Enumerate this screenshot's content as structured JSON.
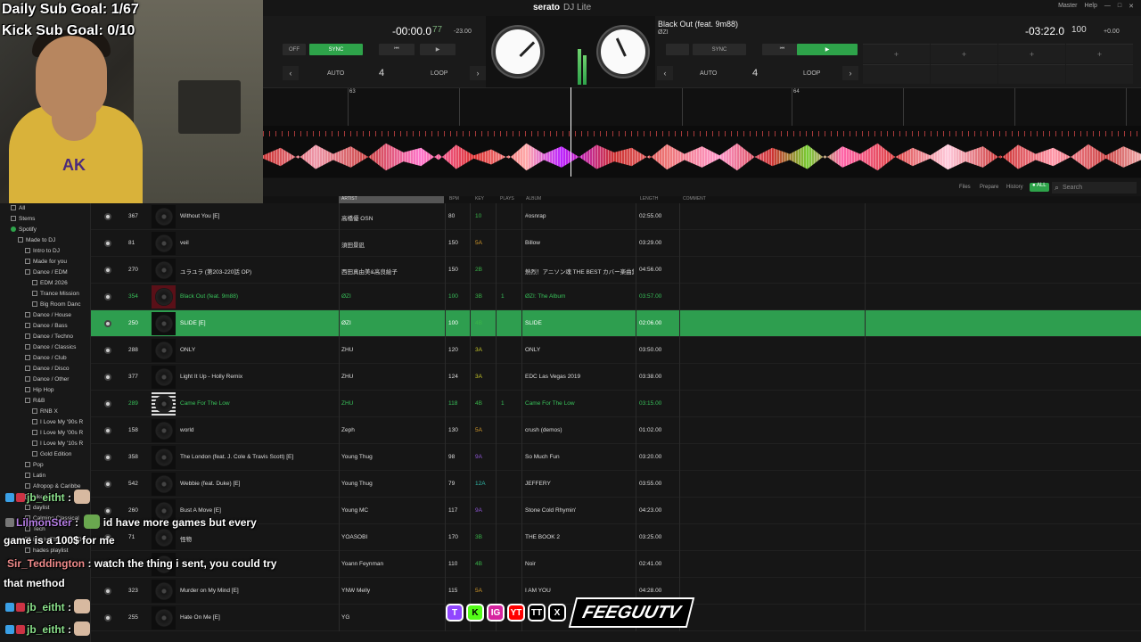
{
  "overlay": {
    "daily_goal": "Daily Sub Goal: 1/67",
    "kick_goal": "Kick Sub Goal: 0/10",
    "brand": "FEEGUUTV",
    "jersey": "AK"
  },
  "app": {
    "logo": "serato",
    "logo_sub": "DJ Lite",
    "top_right": [
      "Master",
      "Help",
      "—",
      "□",
      "✕"
    ]
  },
  "deck_left": {
    "time": "-00:00.0",
    "bpm": "77",
    "offset": "-23.00",
    "off_label": "OFF",
    "sync_label": "SYNC",
    "auto_label": "AUTO",
    "loop_label": "LOOP",
    "loop_value": "4"
  },
  "deck_right": {
    "title": "Black Out (feat. 9m88)",
    "artist": "ØZI",
    "time": "-03:22.0",
    "bpm": "100",
    "offset": "+0.00",
    "sync_label": "SYNC",
    "auto_label": "AUTO",
    "loop_label": "LOOP",
    "loop_value": "4"
  },
  "beat_markers": [
    "63",
    "64"
  ],
  "library": {
    "tools": [
      "Files",
      "Prepare",
      "History"
    ],
    "search_placeholder": "Search",
    "columns": [
      "ARTIST",
      "BPM",
      "KEY",
      "PLAYS",
      "ALBUM",
      "LENGTH",
      "COMMENT"
    ]
  },
  "sidebar": [
    {
      "label": "All"
    },
    {
      "label": "Stems"
    },
    {
      "label": "Spotify"
    },
    {
      "label": "Made to DJ"
    },
    {
      "label": "Intro to DJ"
    },
    {
      "label": "Made for you"
    },
    {
      "label": "Dance / EDM"
    },
    {
      "label": "EDM 2026"
    },
    {
      "label": "Trance Mission"
    },
    {
      "label": "Big Room Danc"
    },
    {
      "label": "Dance / House"
    },
    {
      "label": "Dance / Bass"
    },
    {
      "label": "Dance / Techno"
    },
    {
      "label": "Dance / Classics"
    },
    {
      "label": "Dance / Club"
    },
    {
      "label": "Dance / Disco"
    },
    {
      "label": "Dance / Other"
    },
    {
      "label": "Hip Hop"
    },
    {
      "label": "R&B"
    },
    {
      "label": "RNB X"
    },
    {
      "label": "I Love My '90s R"
    },
    {
      "label": "I Love My '00s R"
    },
    {
      "label": "I Love My '10s R"
    },
    {
      "label": "Gold Edition"
    },
    {
      "label": "Pop"
    },
    {
      "label": "Latin"
    },
    {
      "label": "Afropop & Caribbe"
    },
    {
      "label": "Liked Songs"
    },
    {
      "label": "daylist"
    },
    {
      "label": "Calming Classical"
    },
    {
      "label": "Tech"
    },
    {
      "label": "80s HITS | TOP 10"
    },
    {
      "label": "hades playlist"
    }
  ],
  "tracks": [
    {
      "num": "367",
      "title": "Without You [E]",
      "artist": "高橋優 OSN",
      "bpm": "80",
      "key": "10",
      "plays": "",
      "album": "#osnrap",
      "length": "02:55.00"
    },
    {
      "num": "81",
      "title": "veil",
      "artist": "須田景凪",
      "bpm": "150",
      "key": "5A",
      "plays": "",
      "album": "Billow",
      "length": "03:29.00"
    },
    {
      "num": "270",
      "title": "ユラユラ (第203-220話 OP)",
      "artist": "西田真由美&高良絵子",
      "bpm": "150",
      "key": "2B",
      "plays": "",
      "album": "熱烈！アニソン魂 THE BEST カバー楽曲集 T",
      "length": "04:56.00"
    },
    {
      "num": "354",
      "title": "Black Out (feat. 9m88)",
      "artist": "ØZI",
      "bpm": "100",
      "key": "3B",
      "plays": "1",
      "album": "ØZI: The Album",
      "length": "03:57.00"
    },
    {
      "num": "250",
      "title": "SLIDE [E]",
      "artist": "ØZI",
      "bpm": "100",
      "key": "4B",
      "plays": "",
      "album": "SLIDE",
      "length": "02:06.00"
    },
    {
      "num": "288",
      "title": "ONLY",
      "artist": "ZHU",
      "bpm": "120",
      "key": "3A",
      "plays": "",
      "album": "ONLY",
      "length": "03:50.00"
    },
    {
      "num": "377",
      "title": "Light It Up - Holly Remix",
      "artist": "ZHU",
      "bpm": "124",
      "key": "3A",
      "plays": "",
      "album": "EDC Las Vegas 2019",
      "length": "03:38.00"
    },
    {
      "num": "289",
      "title": "Came For The Low",
      "artist": "ZHU",
      "bpm": "118",
      "key": "4B",
      "plays": "1",
      "album": "Came For The Low",
      "length": "03:15.00"
    },
    {
      "num": "158",
      "title": "world",
      "artist": "Zeph",
      "bpm": "130",
      "key": "5A",
      "plays": "",
      "album": "crush (demos)",
      "length": "01:02.00"
    },
    {
      "num": "358",
      "title": "The London (feat. J. Cole & Travis Scott) [E]",
      "artist": "Young Thug",
      "bpm": "98",
      "key": "9A",
      "plays": "",
      "album": "So Much Fun",
      "length": "03:20.00"
    },
    {
      "num": "542",
      "title": "Webbie (feat. Duke) [E]",
      "artist": "Young Thug",
      "bpm": "79",
      "key": "12A",
      "plays": "",
      "album": "JEFFERY",
      "length": "03:55.00"
    },
    {
      "num": "260",
      "title": "Bust A Move [E]",
      "artist": "Young MC",
      "bpm": "117",
      "key": "9A",
      "plays": "",
      "album": "Stone Cold Rhymin'",
      "length": "04:23.00"
    },
    {
      "num": "71",
      "title": "怪物",
      "artist": "YOASOBI",
      "bpm": "170",
      "key": "3B",
      "plays": "",
      "album": "THE BOOK 2",
      "length": "03:25.00"
    },
    {
      "num": "",
      "title": "",
      "artist": "Yoann Feynman",
      "bpm": "110",
      "key": "4B",
      "plays": "",
      "album": "Noir",
      "length": "02:41.00"
    },
    {
      "num": "323",
      "title": "Murder on My Mind [E]",
      "artist": "YNW Melly",
      "bpm": "115",
      "key": "5A",
      "plays": "",
      "album": "I AM YOU",
      "length": "04:28.00"
    },
    {
      "num": "255",
      "title": "Hate On Me [E]",
      "artist": "YG",
      "bpm": "",
      "key": "",
      "plays": "",
      "album": "",
      "length": "02:45.00"
    }
  ],
  "chat": [
    {
      "user": "jb_eitht",
      "msg": ""
    },
    {
      "user": "LilmonSter",
      "msg": "id have more games but every"
    },
    {
      "user": "",
      "msg": "game is a 100$ for me"
    },
    {
      "user": "Sir_Teddington",
      "msg": "watch the thing i sent, you could try"
    },
    {
      "user": "",
      "msg": "that method"
    },
    {
      "user": "jb_eitht",
      "msg": ""
    },
    {
      "user": "jb_eitht",
      "msg": ""
    }
  ],
  "socials": [
    "T",
    "K",
    "IG",
    "YT",
    "TT",
    "X"
  ]
}
